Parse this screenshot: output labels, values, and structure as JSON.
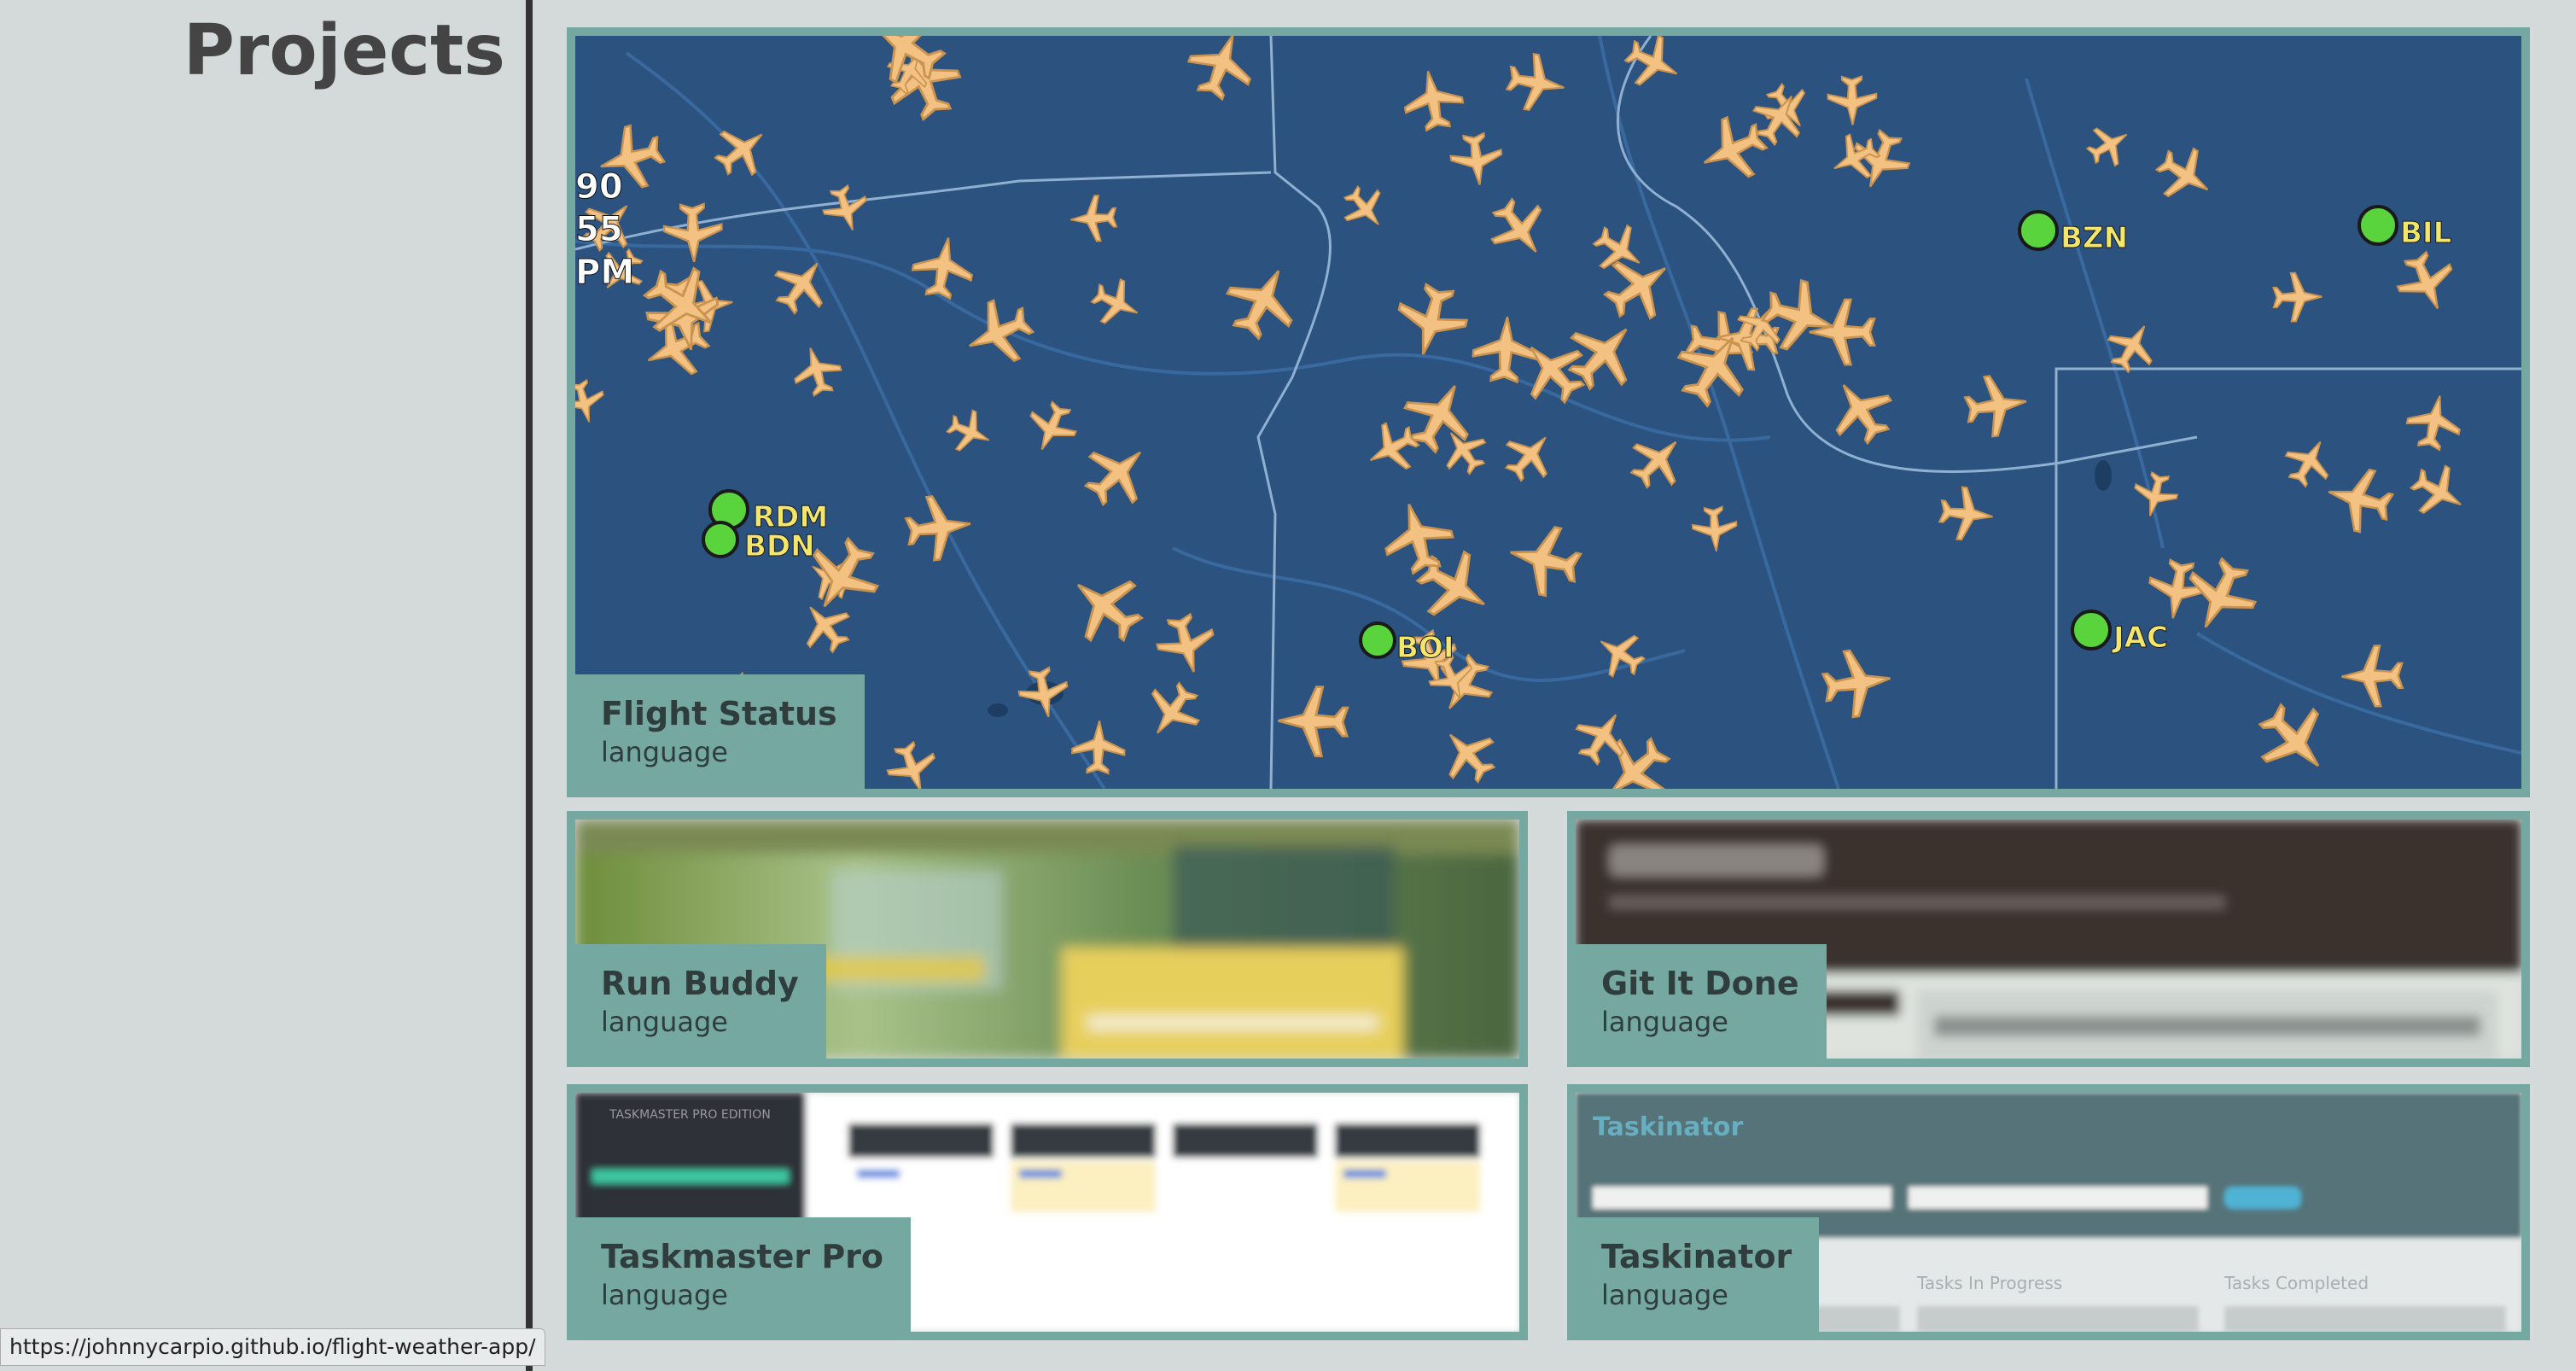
{
  "page": {
    "title": "Projects"
  },
  "projects": [
    {
      "title": "Flight Status",
      "language": "language",
      "airports": [
        "RDM",
        "BDN",
        "BOI",
        "BZN",
        "BIL",
        "JAC"
      ],
      "map_text": [
        "90",
        "55",
        "PM"
      ]
    },
    {
      "title": "Run Buddy",
      "language": "language"
    },
    {
      "title": "Git It Done",
      "language": "language"
    },
    {
      "title": "Taskmaster Pro",
      "language": "language",
      "thumb_text": [
        "TASKMASTER PRO EDITION"
      ]
    },
    {
      "title": "Taskinator",
      "language": "language",
      "thumb_text": [
        "Taskinator",
        "Tasks In Progress",
        "Tasks Completed"
      ]
    }
  ],
  "status_bar": {
    "url": "https://johnnycarpio.github.io/flight-weather-app/"
  },
  "colors": {
    "background": "#d4d9da",
    "card_border": "#76a8a2",
    "label_bg": "#76a8a2",
    "map_water": "#2c5280",
    "plane": "#f3c283",
    "airport_marker": "#5ad43c"
  }
}
